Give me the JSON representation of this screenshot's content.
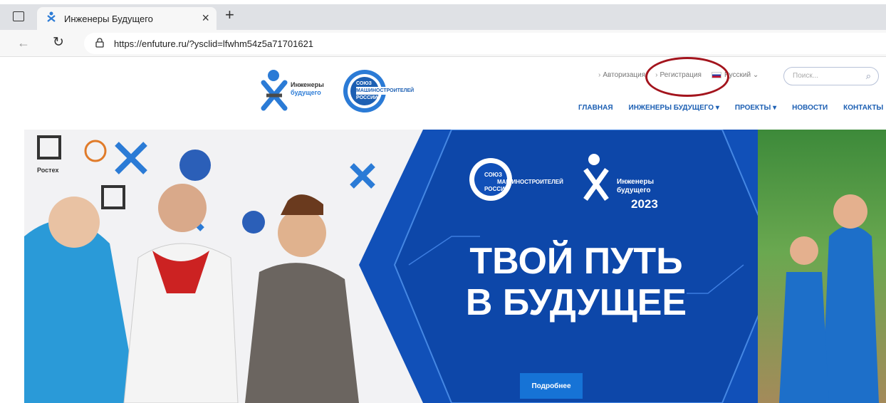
{
  "browser": {
    "tab_title": "Инженеры Будущего",
    "url": "https://enfuture.ru/?ysclid=lfwhm54z5a71701621"
  },
  "icons": {
    "tab_actions": "tab-actions-icon",
    "favicon": "engineers-logo-icon",
    "close": "close-icon",
    "new_tab": "plus-icon",
    "back": "back-arrow-icon",
    "refresh": "refresh-icon",
    "lock": "lock-icon",
    "search": "search-icon"
  },
  "site": {
    "logo_engineers_line1": "Инженеры",
    "logo_engineers_line2": "будущего",
    "logo_union_line1": "СОЮЗ",
    "logo_union_line2": "МАШИНОСТРОИТЕЛЕЙ",
    "logo_union_line3": "РОССИИ",
    "top_links": {
      "login": "Авторизация",
      "register": "Регистрация",
      "language": "Русский"
    },
    "search_placeholder": "Поиск...",
    "main_nav": [
      "ГЛАВНАЯ",
      "ИНЖЕНЕРЫ БУДУЩЕГО",
      "ПРОЕКТЫ",
      "НОВОСТИ",
      "КОНТАКТЫ"
    ]
  },
  "hero": {
    "title_line1": "ТВОЙ ПУТЬ",
    "title_line2": "В БУДУЩЕЕ",
    "year": "2023",
    "button": "Подробнее",
    "banner_word": "Ростех"
  },
  "colors": {
    "brand_blue": "#1c5fb3",
    "hero_blue": "#0b3f9e",
    "button_blue": "#1673d6",
    "annotation_red": "#a3141d"
  }
}
